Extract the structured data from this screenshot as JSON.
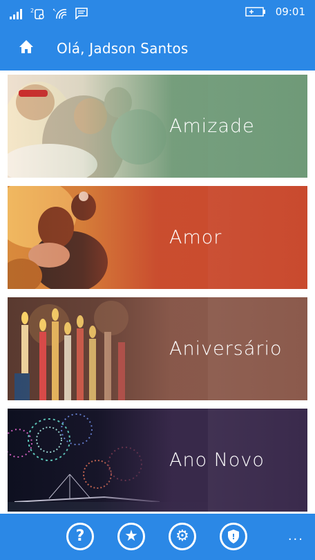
{
  "status_bar": {
    "time": "09:01",
    "icons": [
      "signal-icon",
      "sim-2-icon",
      "wifi-icon",
      "message-icon",
      "battery-charging-icon"
    ]
  },
  "header": {
    "greeting": "Olá, Jadson Santos",
    "home_icon": "home-icon"
  },
  "categories": [
    {
      "label": "Amizade",
      "color": "#6f9a78"
    },
    {
      "label": "Amor",
      "color": "#c94a2e"
    },
    {
      "label": "Aniversário",
      "color": "#8b5a4c"
    },
    {
      "label": "Ano Novo",
      "color": "#3a2a4c"
    }
  ],
  "app_bar": {
    "buttons": [
      {
        "icon": "help-icon",
        "glyph": "?"
      },
      {
        "icon": "star-icon",
        "glyph": "★"
      },
      {
        "icon": "settings-icon",
        "glyph": "⚙"
      },
      {
        "icon": "shield-icon",
        "glyph": "!"
      }
    ],
    "more": "..."
  },
  "colors": {
    "accent": "#2b88e6"
  }
}
